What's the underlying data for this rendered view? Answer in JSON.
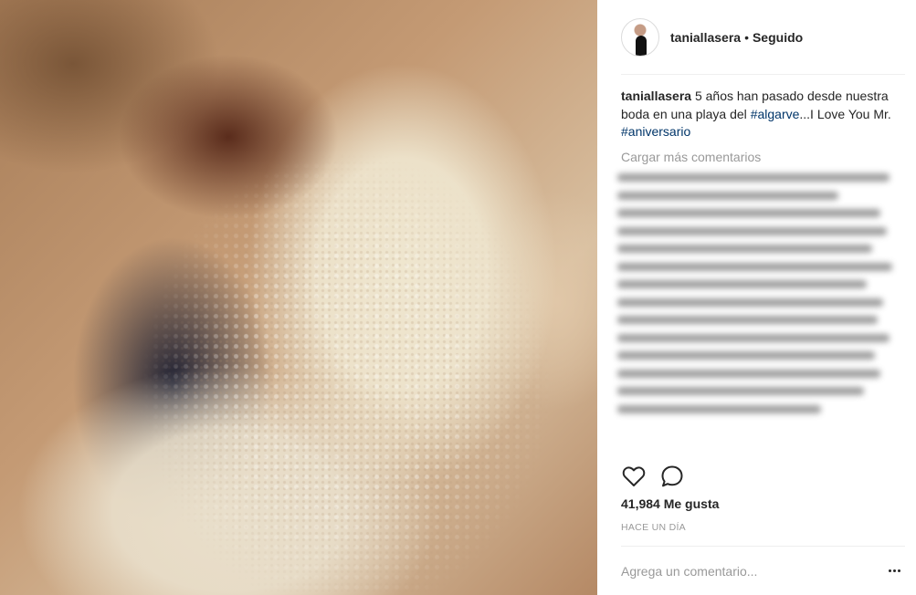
{
  "post": {
    "photo_alt": "wedding photo"
  },
  "header": {
    "username": "taniallasera",
    "separator": "•",
    "follow_status": "Seguido"
  },
  "caption": {
    "username": "taniallasera",
    "text_1": " 5 años han pasado desde nuestra boda en una playa del ",
    "tag_1": "#algarve",
    "text_2": "...I Love You Mr. ",
    "tag_2": "#aniversario"
  },
  "load_more": "Cargar más comentarios",
  "actions": {
    "like_icon": "heart-icon",
    "comment_icon": "comment-icon"
  },
  "likes": "41,984 Me gusta",
  "timestamp": "HACE UN DÍA",
  "comment_box": {
    "placeholder": "Agrega un comentario...",
    "options_icon": "more-options-icon"
  },
  "colors": {
    "hashtag": "#003569",
    "muted": "#999999",
    "text": "#262626"
  }
}
